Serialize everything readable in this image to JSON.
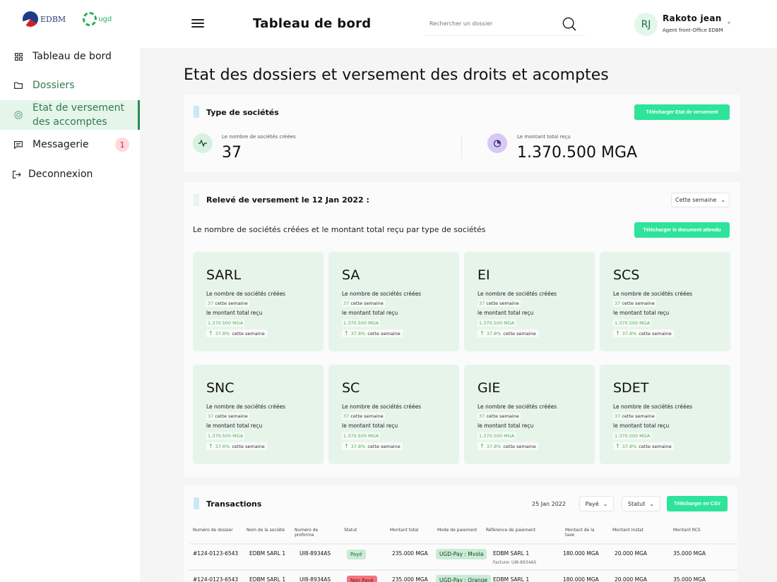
{
  "brand": {
    "logo1": "EDBM",
    "logo2": "ugd"
  },
  "sidebar": {
    "items": [
      {
        "label": "Tableau de bord",
        "icon": "grid-icon"
      },
      {
        "label": "Dossiers",
        "icon": "folder-icon"
      },
      {
        "label": "Etat de versement des accomptes",
        "icon": "coin-icon",
        "active": true
      },
      {
        "label": "Messagerie",
        "icon": "message-icon",
        "badge": "1"
      },
      {
        "label": "Deconnexion",
        "icon": "logout-icon"
      }
    ]
  },
  "header": {
    "title": "Tableau de bord",
    "search_placeholder": "Rechercher un dossier",
    "user_initials": "RJ",
    "user_name": "Rakoto jean",
    "user_role": "Agent front-Office EDBM"
  },
  "page_title": "Etat des dossiers et versement des droits et acomptes",
  "summary": {
    "title": "Type de sociétés",
    "download_label": "Télécharger Etat de versement",
    "stat1_label": "Le nombre de sociétés créées",
    "stat1_value": "37",
    "stat2_label": "Le montant total reçu",
    "stat2_value": "1.370.500 MGA"
  },
  "releve": {
    "title": "Relevé de versement le 12 Jan 2022 :",
    "period": "Cette semaine",
    "subtitle": "Le nombre de sociétés créées et le montant total reçu par type de sociétés",
    "download_label": "Télécharger le document attendu",
    "label_count": "Le nombre de sociétés créées",
    "label_amount": "le montant total reçu",
    "types": [
      {
        "name": "SARL",
        "count": "37",
        "count_suffix": "cette semaine",
        "amount": "1.370.500 MGA",
        "pct": "37.8%",
        "pct_suffix": "cette semaine"
      },
      {
        "name": "SA",
        "count": "37",
        "count_suffix": "cette semaine",
        "amount": "1.370.500 MGA",
        "pct": "37.8%",
        "pct_suffix": "cette semaine"
      },
      {
        "name": "EI",
        "count": "37",
        "count_suffix": "cette semaine",
        "amount": "1.370.500 MGA",
        "pct": "37.8%",
        "pct_suffix": "cette semaine"
      },
      {
        "name": "SCS",
        "count": "37",
        "count_suffix": "cette semaine",
        "amount": "1.370.500 MGA",
        "pct": "37.8%",
        "pct_suffix": "cette semaine"
      },
      {
        "name": "SNC",
        "count": "37",
        "count_suffix": "cette semaine",
        "amount": "1.370.500 MGA",
        "pct": "37.6%",
        "pct_suffix": "cette semaine"
      },
      {
        "name": "SC",
        "count": "37",
        "count_suffix": "cette semaine",
        "amount": "1.370.500 MGA",
        "pct": "37.8%",
        "pct_suffix": "cette semaine"
      },
      {
        "name": "GIE",
        "count": "37",
        "count_suffix": "cette semaine",
        "amount": "1.370.500 MGA",
        "pct": "37.8%",
        "pct_suffix": "cette semaine"
      },
      {
        "name": "SDET",
        "count": "37",
        "count_suffix": "cette semaine",
        "amount": "1.370.500 MGA",
        "pct": "37.8%",
        "pct_suffix": "cette semaine"
      }
    ]
  },
  "transactions": {
    "title": "Transactions",
    "date": "25 Jan 2022",
    "filter_paid": "Payé",
    "filter_status": "Statut",
    "csv_label": "Télécharger en CSV",
    "headers": [
      "Numéro de dossier",
      "Nom de la société",
      "Numéro de proforma",
      "Statut",
      "Montant total",
      "Mode de paiement",
      "Référence de paiement",
      "Montant de la taxe",
      "Montant Instat",
      "Montant RCS"
    ],
    "rows": [
      {
        "dossier": "#124-0123-6543",
        "societe": "EDBM SARL 1",
        "proforma": "UI8-8934AS",
        "statut": "Payé",
        "statut_type": "paid",
        "total": "235.000 MGA",
        "mode": "UGD-Pay : Mvola",
        "reference": "EDBM SARL 1",
        "facture": "Facture: UI8-8934AS",
        "taxe": "180.000 MGA",
        "instat": "20.000 MGA",
        "rcs": "35.000 MGA"
      },
      {
        "dossier": "#124-0123-6543",
        "societe": "EDBM SARL 1",
        "proforma": "UI8-8934AS",
        "statut": "Non Payé",
        "statut_type": "unpaid",
        "total": "235.000 MGA",
        "mode": "UGD-Pay : Orange",
        "reference": "EDBM SARL 1",
        "facture": "",
        "taxe": "180.000 MGA",
        "instat": "20.000 MGA",
        "rcs": "35.000 MGA"
      }
    ]
  }
}
